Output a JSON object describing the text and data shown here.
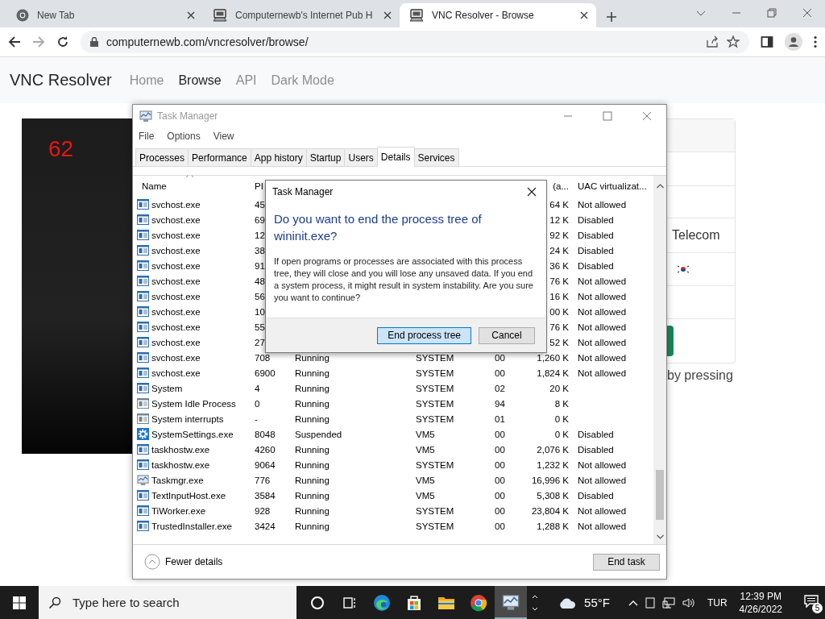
{
  "browser": {
    "tabs": [
      {
        "title": "New Tab",
        "kind": "chrome",
        "selected": false
      },
      {
        "title": "Computernewb's Internet Pub H",
        "kind": "computer",
        "selected": false
      },
      {
        "title": "VNC Resolver - Browse",
        "kind": "computer",
        "selected": true
      }
    ],
    "url": "computernewb.com/vncresolver/browse/"
  },
  "page": {
    "brand": "VNC Resolver",
    "nav": [
      {
        "label": "Home",
        "selected": false
      },
      {
        "label": "Browse",
        "selected": true
      },
      {
        "label": "API",
        "selected": false
      },
      {
        "label": "Dark Mode",
        "selected": false
      }
    ],
    "thumbnail_text": "62",
    "card_text": "Telecom",
    "caption": "by pressing"
  },
  "task_manager": {
    "title": "Task Manager",
    "menu": [
      "File",
      "Options",
      "View"
    ],
    "tabs": [
      {
        "label": "Processes",
        "selected": false
      },
      {
        "label": "Performance",
        "selected": false
      },
      {
        "label": "App history",
        "selected": false
      },
      {
        "label": "Startup",
        "selected": false
      },
      {
        "label": "Users",
        "selected": false
      },
      {
        "label": "Details",
        "selected": true
      },
      {
        "label": "Services",
        "selected": false
      }
    ],
    "columns": {
      "name": "Name",
      "pid": "PI",
      "memory": "(a...",
      "uac": "UAC virtualizat..."
    },
    "rows": [
      {
        "kind": "app",
        "name": "svchost.exe",
        "pid": "45",
        "memory": "64 K",
        "uac": "Not allowed"
      },
      {
        "kind": "app",
        "name": "svchost.exe",
        "pid": "69",
        "memory": "12 K",
        "uac": "Disabled"
      },
      {
        "kind": "app",
        "name": "svchost.exe",
        "pid": "12",
        "memory": "92 K",
        "uac": "Disabled"
      },
      {
        "kind": "app",
        "name": "svchost.exe",
        "pid": "38",
        "memory": "24 K",
        "uac": "Disabled"
      },
      {
        "kind": "app",
        "name": "svchost.exe",
        "pid": "91",
        "memory": "36 K",
        "uac": "Disabled"
      },
      {
        "kind": "app",
        "name": "svchost.exe",
        "pid": "48",
        "memory": "76 K",
        "uac": "Not allowed"
      },
      {
        "kind": "app",
        "name": "svchost.exe",
        "pid": "56",
        "memory": "16 K",
        "uac": "Not allowed"
      },
      {
        "kind": "app",
        "name": "svchost.exe",
        "pid": "10",
        "memory": "00 K",
        "uac": "Not allowed"
      },
      {
        "kind": "app",
        "name": "svchost.exe",
        "pid": "55",
        "memory": "76 K",
        "uac": "Not allowed"
      },
      {
        "kind": "app",
        "name": "svchost.exe",
        "pid": "27",
        "memory": "52 K",
        "uac": "Not allowed"
      },
      {
        "kind": "app",
        "name": "svchost.exe",
        "pid": "708",
        "status": "Running",
        "user": "SYSTEM",
        "cpu": "00",
        "memory": "1,260 K",
        "uac": "Not allowed"
      },
      {
        "kind": "app",
        "name": "svchost.exe",
        "pid": "6900",
        "status": "Running",
        "user": "SYSTEM",
        "cpu": "00",
        "memory": "1,824 K",
        "uac": "Not allowed"
      },
      {
        "kind": "app",
        "name": "System",
        "pid": "4",
        "status": "Running",
        "user": "SYSTEM",
        "cpu": "02",
        "memory": "20 K"
      },
      {
        "kind": "system",
        "name": "System Idle Process",
        "pid": "0",
        "status": "Running",
        "user": "SYSTEM",
        "cpu": "94",
        "memory": "8 K"
      },
      {
        "kind": "system",
        "name": "System interrupts",
        "pid": "-",
        "status": "Running",
        "user": "SYSTEM",
        "cpu": "01",
        "memory": "0 K"
      },
      {
        "kind": "gear",
        "name": "SystemSettings.exe",
        "pid": "8048",
        "status": "Suspended",
        "user": "VM5",
        "cpu": "00",
        "memory": "0 K",
        "uac": "Disabled"
      },
      {
        "kind": "app",
        "name": "taskhostw.exe",
        "pid": "4260",
        "status": "Running",
        "user": "VM5",
        "cpu": "00",
        "memory": "2,076 K",
        "uac": "Disabled"
      },
      {
        "kind": "app",
        "name": "taskhostw.exe",
        "pid": "9064",
        "status": "Running",
        "user": "SYSTEM",
        "cpu": "00",
        "memory": "1,232 K",
        "uac": "Not allowed"
      },
      {
        "kind": "monitor",
        "name": "Taskmgr.exe",
        "pid": "776",
        "status": "Running",
        "user": "VM5",
        "cpu": "00",
        "memory": "16,996 K",
        "uac": "Not allowed"
      },
      {
        "kind": "app",
        "name": "TextInputHost.exe",
        "pid": "3584",
        "status": "Running",
        "user": "VM5",
        "cpu": "00",
        "memory": "5,308 K",
        "uac": "Disabled"
      },
      {
        "kind": "app",
        "name": "TiWorker.exe",
        "pid": "928",
        "status": "Running",
        "user": "SYSTEM",
        "cpu": "00",
        "memory": "23,804 K",
        "uac": "Not allowed"
      },
      {
        "kind": "app",
        "name": "TrustedInstaller.exe",
        "pid": "3424",
        "status": "Running",
        "user": "SYSTEM",
        "cpu": "00",
        "memory": "1,288 K",
        "uac": "Not allowed"
      }
    ],
    "footer_link": "Fewer details",
    "end_task": "End task"
  },
  "dialog": {
    "title": "Task Manager",
    "heading": "Do you want to end the process tree of wininit.exe?",
    "body": "If open programs or processes are associated with this process tree, they will close and you will lose any unsaved data. If you end a system process, it might result in system instability. Are you sure you want to continue?",
    "buttons": [
      {
        "label": "End process tree",
        "selected": true
      },
      {
        "label": "Cancel",
        "selected": false
      }
    ]
  },
  "taskbar": {
    "search_placeholder": "Type here to search",
    "apps": [
      {
        "kind": "circle",
        "selected": false
      },
      {
        "kind": "taskview",
        "selected": false
      },
      {
        "kind": "edge",
        "selected": false
      },
      {
        "kind": "store",
        "selected": false
      },
      {
        "kind": "folder",
        "selected": false
      },
      {
        "kind": "chrome",
        "selected": false
      },
      {
        "kind": "monitor",
        "selected": true
      }
    ],
    "weather": "55°F",
    "language": "TUR",
    "time": "12:39 PM",
    "date": "4/26/2022",
    "notifications": "5"
  }
}
